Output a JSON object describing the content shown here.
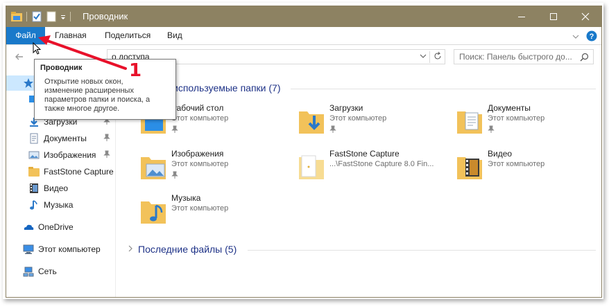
{
  "window": {
    "title": "Проводник",
    "minimize_glyph": "—",
    "maximize_glyph": "☐",
    "close_glyph": "✕"
  },
  "ribbon": {
    "tabs": [
      {
        "label": "Файл"
      },
      {
        "label": "Главная"
      },
      {
        "label": "Поделиться"
      },
      {
        "label": "Вид"
      }
    ],
    "expand_glyph": "⌄",
    "help_glyph": "?"
  },
  "address": {
    "path": "Панель быстрого доступа",
    "visible_path": "о доступа",
    "back_glyph": "←",
    "chevron_glyph": "⌄",
    "refresh_glyph": "↻"
  },
  "search": {
    "placeholder": "Поиск: Панель быстрого до..."
  },
  "tooltip": {
    "title": "Проводник",
    "lines": [
      "Открытие новых окон,",
      "изменение расширенных",
      "параметров папки и поиска, а",
      "также многое другое."
    ]
  },
  "callout": {
    "number": "1",
    "color": "#e8112a"
  },
  "sidebar": {
    "items": [
      {
        "label": "Загрузки",
        "icon": "download-folder-icon",
        "pinned": true
      },
      {
        "label": "Документы",
        "icon": "documents-folder-icon",
        "pinned": true
      },
      {
        "label": "Изображения",
        "icon": "pictures-folder-icon",
        "pinned": true
      },
      {
        "label": "FastStone Capture",
        "icon": "folder-icon",
        "pinned": false
      },
      {
        "label": "Видео",
        "icon": "video-folder-icon",
        "pinned": false
      },
      {
        "label": "Музыка",
        "icon": "music-icon",
        "pinned": false
      },
      {
        "label": "OneDrive",
        "icon": "onedrive-icon",
        "pinned": false
      },
      {
        "label": "Этот компьютер",
        "icon": "computer-icon",
        "pinned": false
      },
      {
        "label": "Сеть",
        "icon": "network-icon",
        "pinned": false
      }
    ],
    "pin_glyph": "📌"
  },
  "frequent": {
    "header": "Часто используемые папки (7)",
    "visible_header": "используемые папки (7)",
    "folders": [
      {
        "name": "Рабочий стол",
        "location": "Этот компьютер",
        "pinned": true
      },
      {
        "name": "Загрузки",
        "location": "Этот компьютер",
        "pinned": true
      },
      {
        "name": "Документы",
        "location": "Этот компьютер",
        "pinned": true
      },
      {
        "name": "Изображения",
        "location": "Этот компьютер",
        "pinned": true
      },
      {
        "name": "FastStone Capture",
        "location": "...\\FastStone Capture 8.0 Fin...",
        "pinned": false
      },
      {
        "name": "Видео",
        "location": "Этот компьютер",
        "pinned": false
      },
      {
        "name": "Музыка",
        "location": "Этот компьютер",
        "pinned": false
      }
    ]
  },
  "recent": {
    "header": "Последние файлы (5)",
    "chevron": "›"
  },
  "colors": {
    "titlebar": "#8d8262",
    "file_tab": "#1979ca",
    "header_text": "#1e3287",
    "folder": "#f2c25a"
  }
}
